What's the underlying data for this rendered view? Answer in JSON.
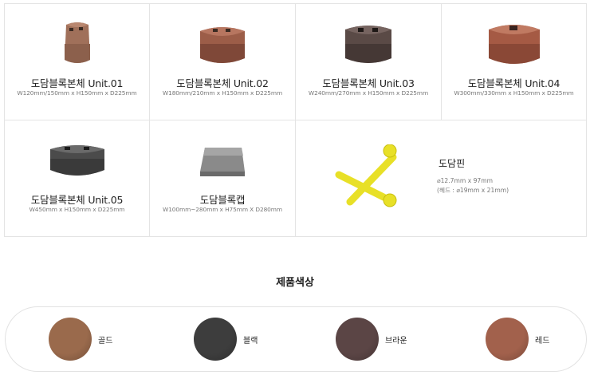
{
  "products": [
    {
      "name": "도담블록본체 Unit.01",
      "spec": "W120mm/150mm x H150mm x D225mm"
    },
    {
      "name": "도담블록본체 Unit.02",
      "spec": "W180mm/210mm x H150mm x D225mm"
    },
    {
      "name": "도담블록본체 Unit.03",
      "spec": "W240mm/270mm x H150mm x D225mm"
    },
    {
      "name": "도담블록본체 Unit.04",
      "spec": "W300mm/330mm x H150mm x D225mm"
    },
    {
      "name": "도담블록본체 Unit.05",
      "spec": "W450mm x H150mm x D225mm"
    },
    {
      "name": "도담블록캡",
      "spec": "W100mm~280mm x H75mm X D280mm"
    }
  ],
  "pin": {
    "name": "도담핀",
    "spec_line1": "⌀12.7mm x 97mm",
    "spec_line2": "(헤드 : ⌀19mm x 21mm)"
  },
  "colors_section": {
    "title": "제품색상",
    "items": [
      {
        "label": "골드",
        "color": "#9a6a4c"
      },
      {
        "label": "블랙",
        "color": "#3d3d3d"
      },
      {
        "label": "브라운",
        "color": "#5b4545"
      },
      {
        "label": "레드",
        "color": "#a2614c"
      }
    ]
  },
  "pin_color": "#e8e027"
}
